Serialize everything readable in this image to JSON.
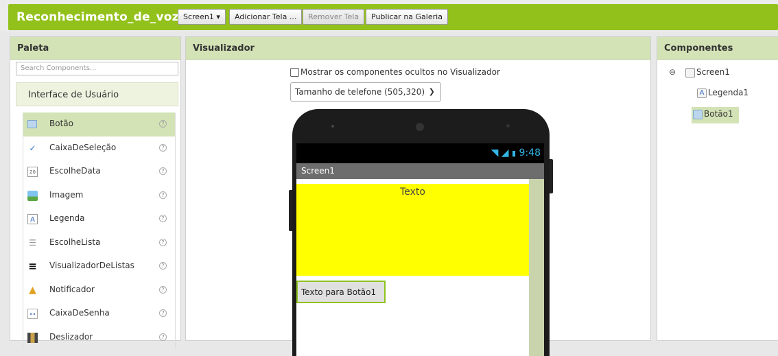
{
  "header": {
    "app_title": "Reconhecimento_de_voz",
    "screen_dropdown": "Screen1 ▾",
    "add_screen": "Adicionar Tela ...",
    "remove_screen": "Remover Tela",
    "publish": "Publicar na Galeria",
    "brand_color": "#93c11b"
  },
  "palette": {
    "title": "Paleta",
    "search_placeholder": "Search Components...",
    "category": "Interface de Usuário",
    "items": [
      {
        "label": "Botão",
        "icon": "button-icon",
        "selected": true
      },
      {
        "label": "CaixaDeSeleção",
        "icon": "checkbox-icon"
      },
      {
        "label": "EscolheData",
        "icon": "calendar-icon"
      },
      {
        "label": "Imagem",
        "icon": "image-icon"
      },
      {
        "label": "Legenda",
        "icon": "label-icon"
      },
      {
        "label": "EscolheLista",
        "icon": "list-picker-icon"
      },
      {
        "label": "VisualizadorDeListas",
        "icon": "list-view-icon"
      },
      {
        "label": "Notificador",
        "icon": "warning-icon"
      },
      {
        "label": "CaixaDeSenha",
        "icon": "password-icon"
      },
      {
        "label": "Deslizador",
        "icon": "slider-icon"
      }
    ],
    "help": "?"
  },
  "viewer": {
    "title": "Visualizador",
    "show_hidden": "Mostrar os componentes ocultos no Visualizador",
    "phone_size": "Tamanho de telefone (505,320)",
    "clock": "9:48",
    "screen_title": "Screen1",
    "label_text": "Texto",
    "button_text": "Texto para Botão1"
  },
  "components": {
    "title": "Componentes",
    "root": "Screen1",
    "collapse": "⊖",
    "children": [
      "Legenda1",
      "Botão1"
    ]
  }
}
